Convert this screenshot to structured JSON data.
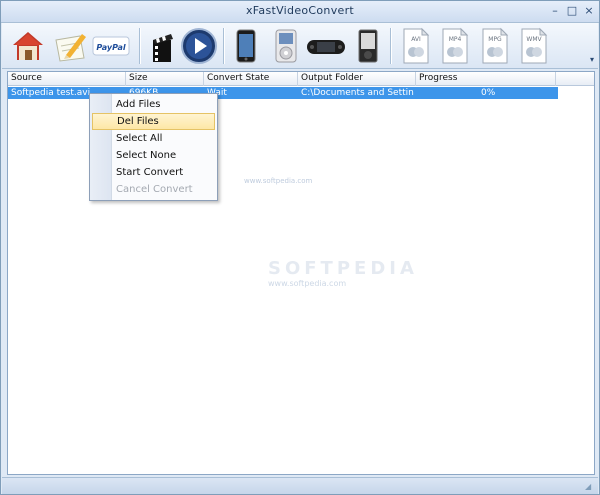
{
  "window": {
    "title": "xFastVideoConvert",
    "minimize": "–",
    "maximize": "□",
    "close": "×"
  },
  "toolbar": {
    "buttons": [
      {
        "name": "home-icon",
        "label": ""
      },
      {
        "name": "edit-icon",
        "label": ""
      },
      {
        "name": "paypal-icon",
        "label": "PayPal"
      },
      {
        "name": "clapper-icon",
        "label": ""
      },
      {
        "name": "play-icon",
        "label": ""
      },
      {
        "name": "iphone-icon",
        "label": ""
      },
      {
        "name": "ipod-icon",
        "label": ""
      },
      {
        "name": "psp-icon",
        "label": ""
      },
      {
        "name": "zune-icon",
        "label": ""
      },
      {
        "name": "avi-format-icon",
        "label": "AVI"
      },
      {
        "name": "mp4-format-icon",
        "label": "MP4"
      },
      {
        "name": "mpg-format-icon",
        "label": "MPG"
      },
      {
        "name": "wmv-format-icon",
        "label": "WMV"
      }
    ],
    "overflow": "▾"
  },
  "list": {
    "columns": [
      "Source",
      "Size",
      "Convert State",
      "Output Folder",
      "Progress"
    ],
    "rows": [
      {
        "source": "Softpedia test.avi",
        "size": "696KB",
        "state": "Wait",
        "folder": "C:\\Documents and Settings\\",
        "progress": "0%"
      }
    ]
  },
  "context_menu": {
    "items": [
      {
        "label": "Add Files",
        "enabled": true
      },
      {
        "label": "Del Files",
        "enabled": true,
        "highlighted": true
      },
      {
        "label": "Select All",
        "enabled": true
      },
      {
        "label": "Select None",
        "enabled": true
      },
      {
        "label": "Start Convert",
        "enabled": true
      },
      {
        "label": "Cancel Convert",
        "enabled": false
      }
    ]
  },
  "watermark": {
    "text": "SOFTPEDIA",
    "url": "www.softpedia.com"
  },
  "colors": {
    "selection": "#3d95ea",
    "menu_highlight": "#fde7a6",
    "toolbar": "#dbe6f4"
  }
}
